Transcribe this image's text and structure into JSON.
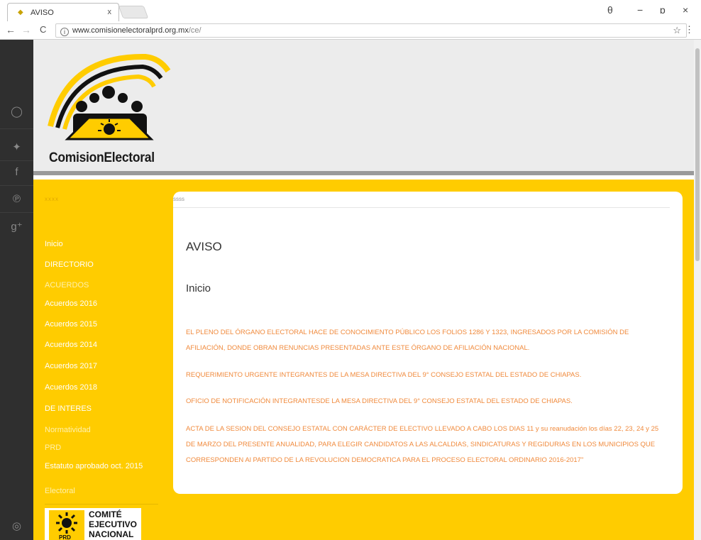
{
  "browser": {
    "tab_title": "AVISO",
    "tab_close": "x",
    "url_host": "www.comisionelectoralprd.org.mx",
    "url_path": "/ce/",
    "info_icon_char": "i",
    "star_char": "☆",
    "menu_char": "⋮",
    "back_char": "←",
    "forward_char": "→",
    "reload_char": "C",
    "profile_char": "θ",
    "minimize_char": "−",
    "restore_char": "ɒ",
    "close_char": "×"
  },
  "social": {
    "icons": [
      "search-icon",
      "twitter-icon",
      "facebook-icon",
      "pinterest-icon",
      "googleplus-icon",
      "circle-icon"
    ],
    "chars": [
      "◯",
      "✦",
      "f",
      "℗",
      "g⁺",
      "◎"
    ]
  },
  "header": {
    "logo_text": "ComisionElectoral"
  },
  "sidebar": {
    "heading": "xxxx",
    "items": [
      {
        "label": "Inicio"
      },
      {
        "label": "DIRECTORIO"
      },
      {
        "label": "ACUERDOS"
      },
      {
        "label": "Acuerdos 2016"
      },
      {
        "label": "Acuerdos 2015"
      },
      {
        "label": "Acuerdos 2014"
      },
      {
        "label": "Acuerdos 2017"
      },
      {
        "label": "Acuerdos 2018"
      },
      {
        "label": "DE INTERES"
      },
      {
        "label": "Normatividad"
      },
      {
        "label": "PRD"
      },
      {
        "label": "Estatuto aprobado oct. 2015"
      },
      {
        "label": "Electoral"
      }
    ],
    "comite_lines": [
      "COMITÉ",
      "EJECUTIVO",
      "NACIONAL"
    ],
    "comite_logo_label": "PRD"
  },
  "content": {
    "header": "ssss",
    "title": "AVISO",
    "subtitle": "Inicio",
    "notices": [
      "EL PLENO DEL ÓRGANO ELECTORAL HACE DE CONOCIMIENTO PÚBLICO LOS FOLIOS 1286 Y 1323, INGRESADOS POR LA COMISIÓN DE AFILIACIÓN, DONDE OBRAN RENUNCIAS PRESENTADAS ANTE ESTE ÓRGANO DE AFILIACIÓN NACIONAL.",
      "REQUERIMIENTO URGENTE INTEGRANTES DE LA MESA DIRECTIVA DEL 9° CONSEJO ESTATAL DEL ESTADO DE CHIAPAS.",
      "OFICIO DE NOTIFICACIÓN INTEGRANTESDE LA MESA DIRECTIVA DEL 9° CONSEJO ESTATAL DEL ESTADO DE CHIAPAS.",
      "ACTA DE LA SESION DEL CONSEJO ESTATAL CON CARÁCTER DE ELECTIVO LLEVADO A CABO LOS DIAS 11 y su reanudación los días 22, 23, 24 y 25 DE MARZO DEL PRESENTE ANUALIDAD, PARA ELEGIR CANDIDATOS A LAS ALCALDIAS, SINDICATURAS Y REGIDURIAS EN LOS MUNICIPIOS QUE CORRESPONDEN Al PARTIDO DE LA REVOLUCION DEMOCRATICA PARA EL PROCESO ELECTORAL ORDINARIO 2016-2017\""
    ]
  },
  "colors": {
    "yellow": "#ffcc00",
    "notice": "#f08a3c",
    "dark": "#2f2f2f"
  }
}
